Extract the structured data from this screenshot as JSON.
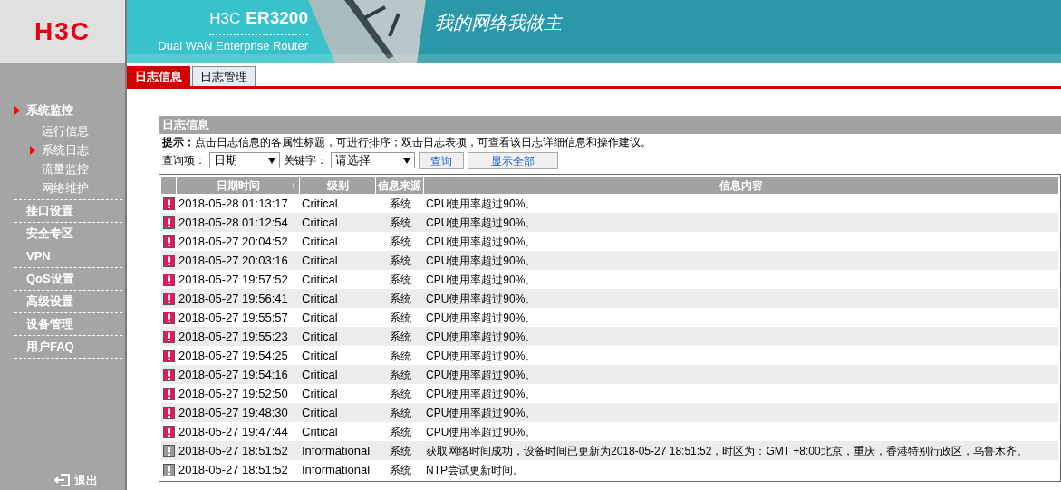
{
  "header": {
    "logo": "H3C",
    "brand": "H3C",
    "model": "ER3200",
    "subtitle": "Dual WAN Enterprise Router",
    "slogan": "我的网络我做主"
  },
  "tabs": [
    {
      "label": "日志信息",
      "selected": true
    },
    {
      "label": "日志管理",
      "selected": false
    }
  ],
  "sidebar": {
    "items": [
      {
        "label": "系统监控",
        "selected": true,
        "children": [
          {
            "label": "运行信息",
            "selected": false
          },
          {
            "label": "系统日志",
            "selected": true
          },
          {
            "label": "流量监控",
            "selected": false
          },
          {
            "label": "网络维护",
            "selected": false
          }
        ]
      },
      {
        "label": "接口设置",
        "selected": false
      },
      {
        "label": "安全专区",
        "selected": false
      },
      {
        "label": "VPN",
        "selected": false
      },
      {
        "label": "QoS设置",
        "selected": false
      },
      {
        "label": "高级设置",
        "selected": false
      },
      {
        "label": "设备管理",
        "selected": false
      },
      {
        "label": "用户FAQ",
        "selected": false
      }
    ],
    "logout": "退出"
  },
  "panel": {
    "title": "日志信息",
    "hint_label": "提示：",
    "hint": "点击日志信息的各属性标题，可进行排序；双击日志表项，可查看该日志详细信息和操作建议。",
    "query_label": "查询项：",
    "query_value": "日期",
    "keyword_label": "关键字：",
    "keyword_value": "请选择",
    "search_button": "查询",
    "show_all_button": "显示全部"
  },
  "table": {
    "columns": [
      "日期时间",
      "级别",
      "信息来源",
      "信息内容"
    ],
    "sort_mark": "↑",
    "rows": [
      {
        "kind": "critical",
        "time": "2018-05-28 01:13:17",
        "level": "Critical",
        "source": "系统",
        "message": "CPU使用率超过90%。"
      },
      {
        "kind": "critical",
        "time": "2018-05-28 01:12:54",
        "level": "Critical",
        "source": "系统",
        "message": "CPU使用率超过90%。"
      },
      {
        "kind": "critical",
        "time": "2018-05-27 20:04:52",
        "level": "Critical",
        "source": "系统",
        "message": "CPU使用率超过90%。"
      },
      {
        "kind": "critical",
        "time": "2018-05-27 20:03:16",
        "level": "Critical",
        "source": "系统",
        "message": "CPU使用率超过90%。"
      },
      {
        "kind": "critical",
        "time": "2018-05-27 19:57:52",
        "level": "Critical",
        "source": "系统",
        "message": "CPU使用率超过90%。"
      },
      {
        "kind": "critical",
        "time": "2018-05-27 19:56:41",
        "level": "Critical",
        "source": "系统",
        "message": "CPU使用率超过90%。"
      },
      {
        "kind": "critical",
        "time": "2018-05-27 19:55:57",
        "level": "Critical",
        "source": "系统",
        "message": "CPU使用率超过90%。"
      },
      {
        "kind": "critical",
        "time": "2018-05-27 19:55:23",
        "level": "Critical",
        "source": "系统",
        "message": "CPU使用率超过90%。"
      },
      {
        "kind": "critical",
        "time": "2018-05-27 19:54:25",
        "level": "Critical",
        "source": "系统",
        "message": "CPU使用率超过90%。"
      },
      {
        "kind": "critical",
        "time": "2018-05-27 19:54:16",
        "level": "Critical",
        "source": "系统",
        "message": "CPU使用率超过90%。"
      },
      {
        "kind": "critical",
        "time": "2018-05-27 19:52:50",
        "level": "Critical",
        "source": "系统",
        "message": "CPU使用率超过90%。"
      },
      {
        "kind": "critical",
        "time": "2018-05-27 19:48:30",
        "level": "Critical",
        "source": "系统",
        "message": "CPU使用率超过90%。"
      },
      {
        "kind": "critical",
        "time": "2018-05-27 19:47:44",
        "level": "Critical",
        "source": "系统",
        "message": "CPU使用率超过90%。"
      },
      {
        "kind": "informational",
        "time": "2018-05-27 18:51:52",
        "level": "Informational",
        "source": "系统",
        "message": "获取网络时间成功，设备时间已更新为2018-05-27 18:51:52，时区为：GMT +8:00北京，重庆，香港特别行政区，乌鲁木齐。"
      },
      {
        "kind": "informational",
        "time": "2018-05-27 18:51:52",
        "level": "Informational",
        "source": "系统",
        "message": "NTP尝试更新时间。"
      }
    ]
  }
}
